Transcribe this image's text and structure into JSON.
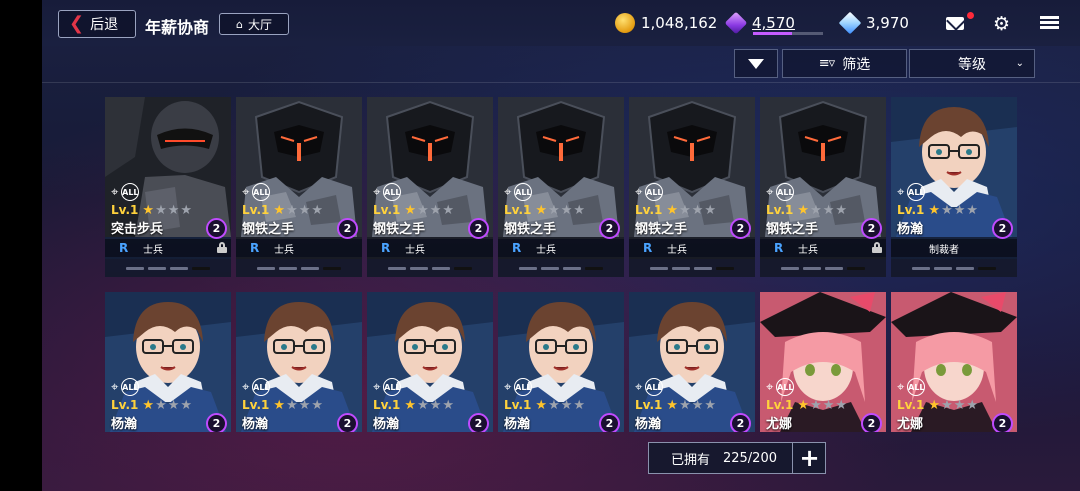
{
  "header": {
    "back_label": "后退",
    "title": "年薪协商",
    "lobby_label": "大厅",
    "gold": "1,048,162",
    "gems": "4,570",
    "gem_progress": 0.55,
    "diamonds": "3,970"
  },
  "filters": {
    "filter_label": "筛选",
    "sort_label": "等级"
  },
  "cards": [
    {
      "type": "soldier",
      "lv": "Lv.1",
      "stars_on": 1,
      "stars_total": 4,
      "name": "突击步兵",
      "rank": "2",
      "rank_letter": "R",
      "role": "士兵",
      "locked": true
    },
    {
      "type": "robot",
      "lv": "Lv.1",
      "stars_on": 1,
      "stars_total": 4,
      "name": "钢铁之手",
      "rank": "2",
      "rank_letter": "R",
      "role": "士兵",
      "locked": false
    },
    {
      "type": "robot",
      "lv": "Lv.1",
      "stars_on": 1,
      "stars_total": 4,
      "name": "钢铁之手",
      "rank": "2",
      "rank_letter": "R",
      "role": "士兵",
      "locked": false
    },
    {
      "type": "robot",
      "lv": "Lv.1",
      "stars_on": 1,
      "stars_total": 4,
      "name": "钢铁之手",
      "rank": "2",
      "rank_letter": "R",
      "role": "士兵",
      "locked": false
    },
    {
      "type": "robot",
      "lv": "Lv.1",
      "stars_on": 1,
      "stars_total": 4,
      "name": "钢铁之手",
      "rank": "2",
      "rank_letter": "R",
      "role": "士兵",
      "locked": false
    },
    {
      "type": "robot",
      "lv": "Lv.1",
      "stars_on": 1,
      "stars_total": 4,
      "name": "钢铁之手",
      "rank": "2",
      "rank_letter": "R",
      "role": "士兵",
      "locked": true
    },
    {
      "type": "boy",
      "lv": "Lv.1",
      "stars_on": 1,
      "stars_total": 4,
      "name": "杨瀚",
      "rank": "2",
      "rank_letter": "",
      "role": "制裁者",
      "locked": false
    },
    {
      "type": "boy",
      "lv": "Lv.1",
      "stars_on": 1,
      "stars_total": 4,
      "name": "杨瀚",
      "rank": "2"
    },
    {
      "type": "boy",
      "lv": "Lv.1",
      "stars_on": 1,
      "stars_total": 4,
      "name": "杨瀚",
      "rank": "2"
    },
    {
      "type": "boy",
      "lv": "Lv.1",
      "stars_on": 1,
      "stars_total": 4,
      "name": "杨瀚",
      "rank": "2"
    },
    {
      "type": "boy",
      "lv": "Lv.1",
      "stars_on": 1,
      "stars_total": 4,
      "name": "杨瀚",
      "rank": "2"
    },
    {
      "type": "boy",
      "lv": "Lv.1",
      "stars_on": 1,
      "stars_total": 4,
      "name": "杨瀚",
      "rank": "2"
    },
    {
      "type": "girl",
      "lv": "Lv.1",
      "stars_on": 1,
      "stars_total": 4,
      "name": "尤娜",
      "rank": "2"
    },
    {
      "type": "girl",
      "lv": "Lv.1",
      "stars_on": 1,
      "stars_total": 4,
      "name": "尤娜",
      "rank": "2"
    }
  ],
  "footer": {
    "owned_label": "已拥有",
    "owned_count": "225/200",
    "add_label": "+"
  },
  "colors": {
    "accent_red": "#e23548",
    "level_yellow": "#ffd23c",
    "rank_purple": "#c04bff",
    "rank_letter_blue": "#4aa3ff"
  }
}
